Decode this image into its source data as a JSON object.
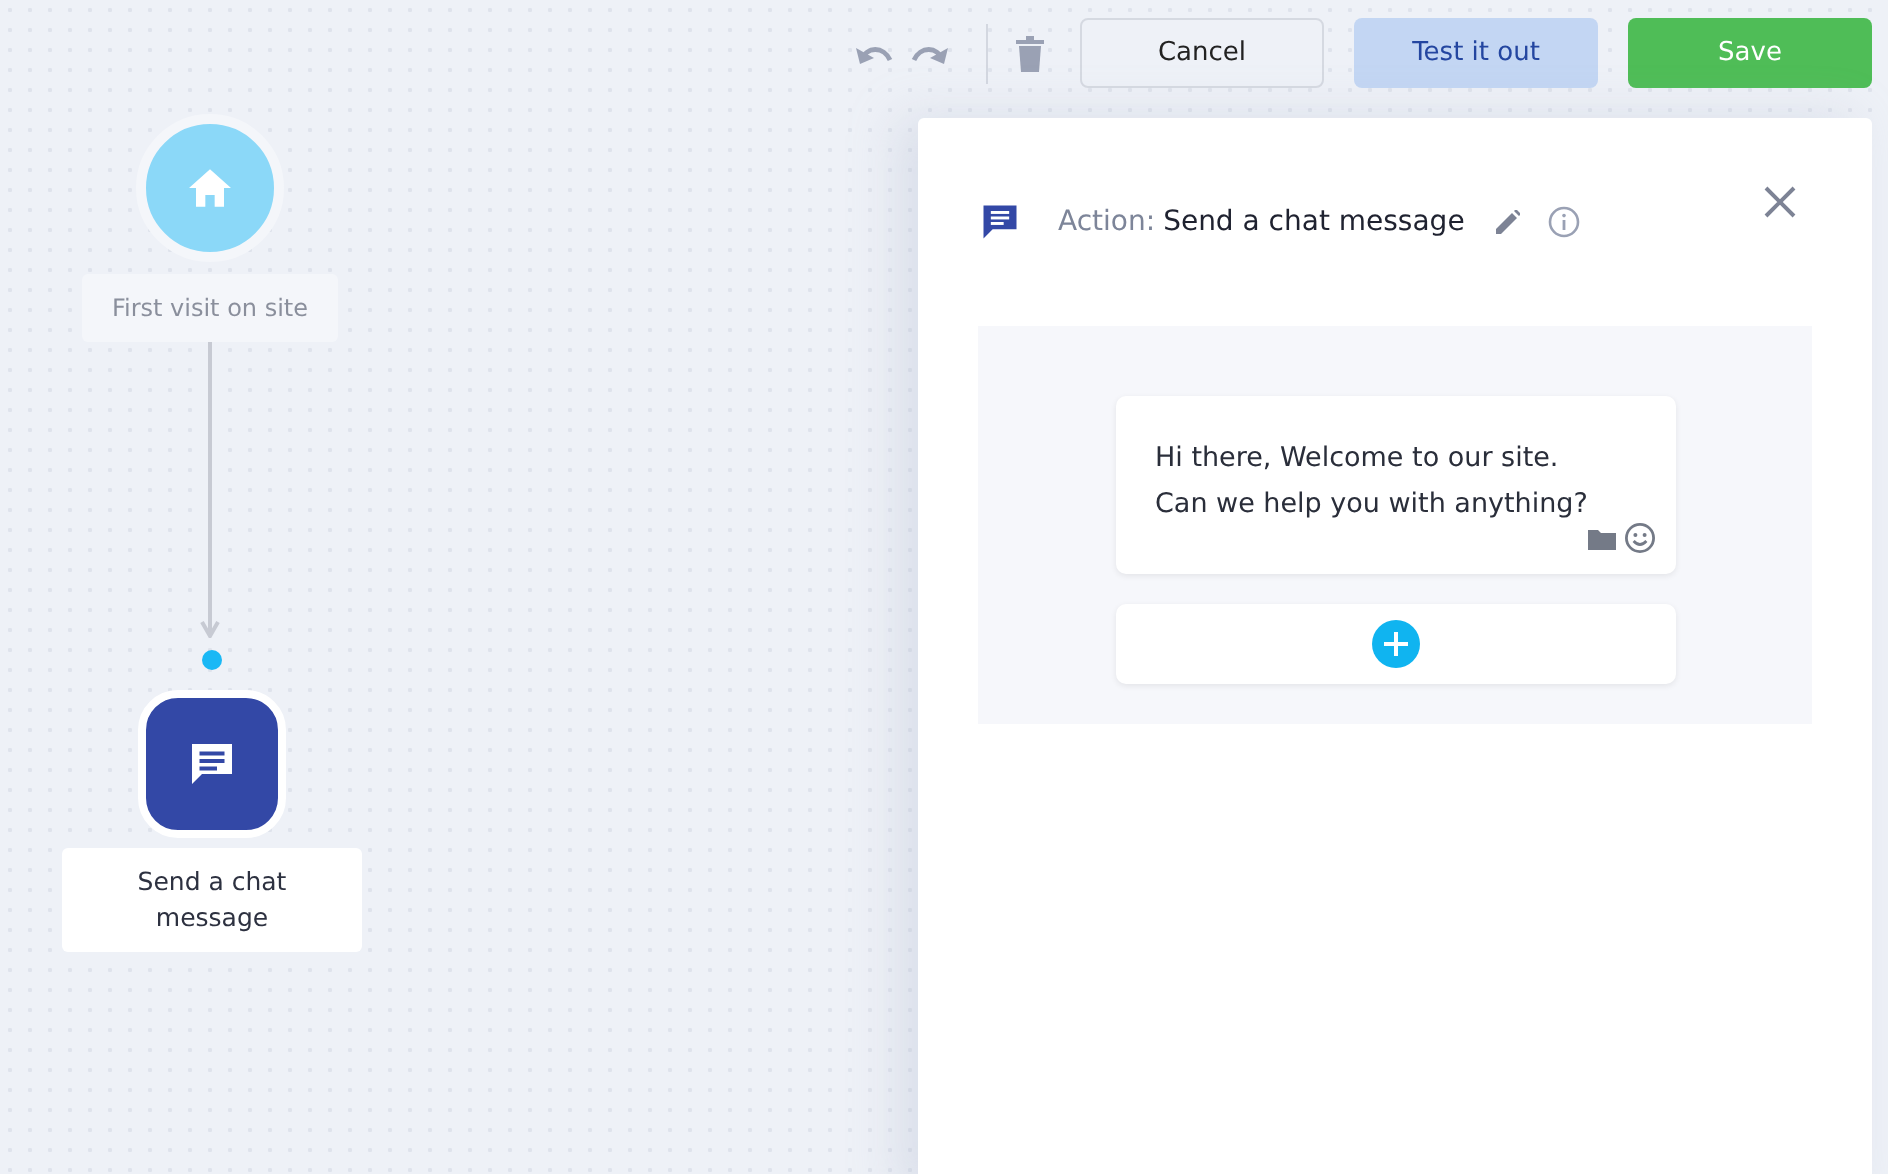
{
  "toolbar": {
    "buttons": [
      {
        "label": "Cancel",
        "kind": "secondary"
      },
      {
        "label": "Test it out",
        "kind": "test"
      },
      {
        "label": "Save",
        "kind": "primary"
      }
    ]
  },
  "canvas": {
    "nodes": [
      {
        "kind": "trigger",
        "label": "First visit on site"
      },
      {
        "kind": "action",
        "label": "Send a chat message"
      }
    ]
  },
  "panel": {
    "prefix": "Action:",
    "title": "Send a chat message",
    "message": "Hi there, Welcome to our site.\nCan we help you with anything?"
  }
}
